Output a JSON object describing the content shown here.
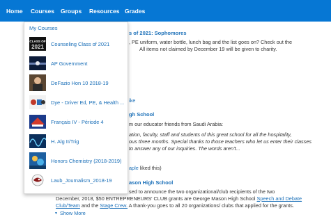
{
  "nav": {
    "items": [
      "Home",
      "Courses",
      "Groups",
      "Resources",
      "Grades"
    ],
    "courses_caret": "▲"
  },
  "feed": {
    "post1": {
      "title_fragment": "s of 2021: Sophomores",
      "line1": ", PE uniform, water bottle, lunch bag and the list goes on?  Check out the",
      "line2": "All items not claimed by December 19 will be given to charity."
    },
    "like_fragment": "ike",
    "post2": {
      "title_fragment": "gh School",
      "line1": "m our educator friends from Saudi Arabia:",
      "line2": "ation, faculty, staff and students of this great school for all the hospitality,",
      "line3": "ous three months. Special thanks to those teachers who let us enter their classes",
      "line4": "to answer any of our inquiries. The words aren't..."
    },
    "liked_fragment": "aple",
    "liked_suffix": " liked this)",
    "post3": {
      "title_fragment": "ason High School",
      "line1": "sed to announce the two organizational/club recipients of the two",
      "line2_pre": "December, 2018, $50 ENTREPRENEURS' CLUB grants are George Mason High School ",
      "line2_link": "Speech and Debate",
      "line3_link1": "Club/Team",
      "line3_mid": " and the ",
      "line3_link2": "Stage Crew.",
      "line3_post": "  A thank-you goes to all 20 organizations/ clubs that applied for the grants."
    },
    "show_more": "Show More"
  },
  "dropdown": {
    "header": "My Courses",
    "courses": [
      {
        "label": "Counseling Class of 2021",
        "thumb_text": "CLASS OF 2021"
      },
      {
        "label": "AP Government"
      },
      {
        "label": "DeFazio Hon 10 2018-19"
      },
      {
        "label": "Dye - Driver Ed, PE, & Health ..."
      },
      {
        "label": "Français IV - Période 4"
      },
      {
        "label": "H. Alg II/Trig"
      },
      {
        "label": "Honors Chemistry (2018-2019)"
      },
      {
        "label": "Laub_Journalism_2018-19"
      }
    ]
  },
  "colors": {
    "nav_bg": "#0677d4",
    "link": "#1a6fb8"
  }
}
